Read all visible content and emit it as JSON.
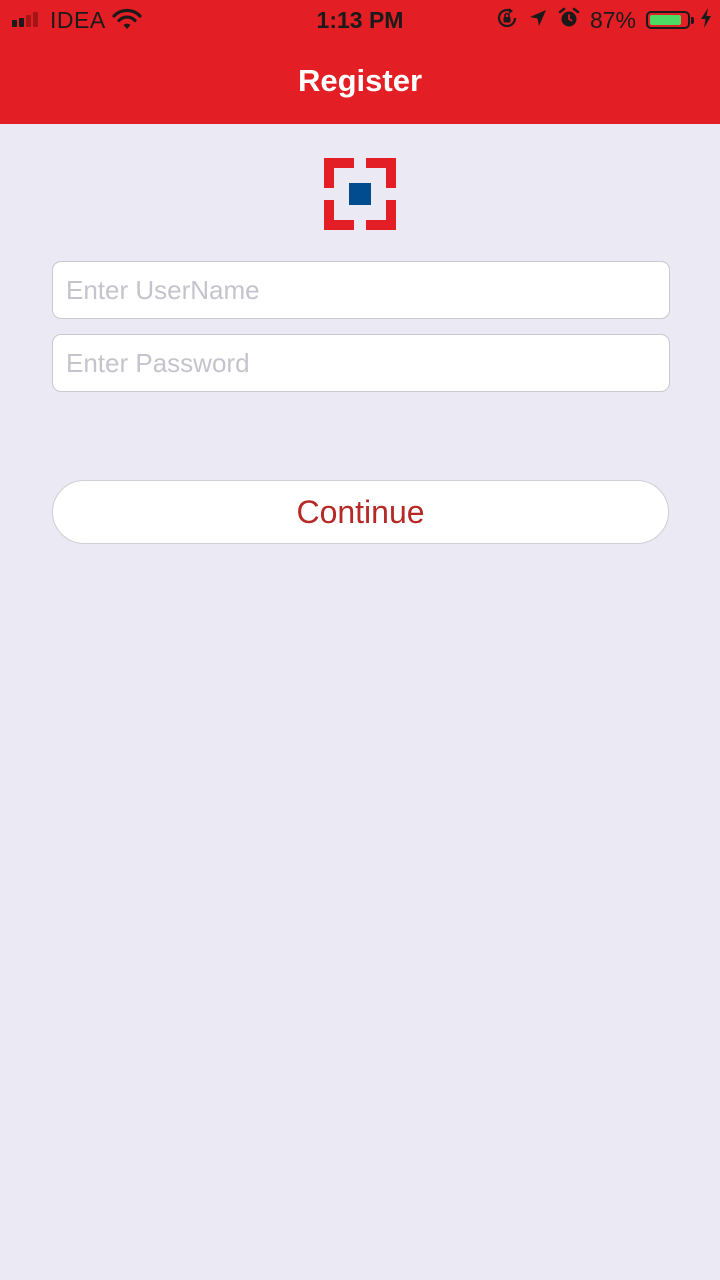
{
  "status_bar": {
    "carrier": "IDEA",
    "time": "1:13 PM",
    "battery_percent": "87%",
    "battery_level": 0.87,
    "icons": [
      "signal-icon",
      "wifi-icon",
      "orientation-lock-icon",
      "location-arrow-icon",
      "alarm-icon",
      "battery-icon",
      "charging-bolt-icon"
    ]
  },
  "header": {
    "title": "Register",
    "background_color": "#e31e24"
  },
  "logo": {
    "icon": "bank-logo-icon",
    "colors": {
      "frame": "#e31e24",
      "center": "#004c8f"
    }
  },
  "form": {
    "username_placeholder": "Enter UserName",
    "username_value": "",
    "password_placeholder": "Enter Password",
    "password_value": "",
    "continue_label": "Continue",
    "accent_color": "#b52a27"
  },
  "page": {
    "background_color": "#ebe9f3"
  }
}
